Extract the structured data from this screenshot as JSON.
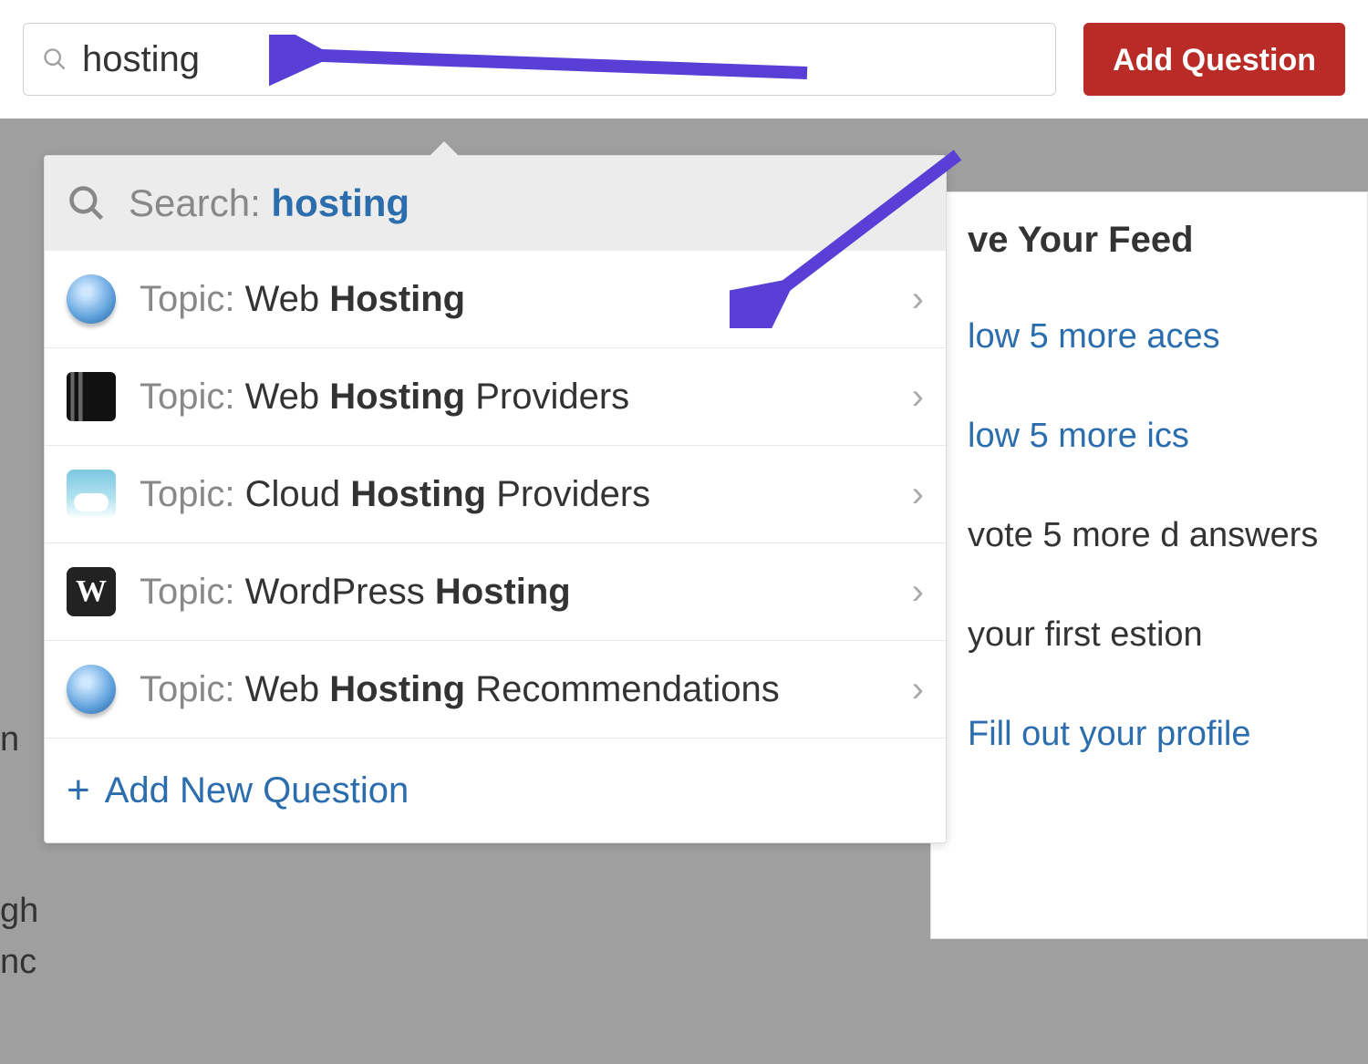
{
  "search": {
    "value": "hosting",
    "placeholder": ""
  },
  "add_question_button": "Add Question",
  "dropdown": {
    "search_label": "Search: ",
    "search_term": "hosting",
    "items": [
      {
        "prefix": "Topic: ",
        "pre": "Web ",
        "bold": "Hosting",
        "post": "",
        "icon": "globe"
      },
      {
        "prefix": "Topic: ",
        "pre": "Web ",
        "bold": "Hosting",
        "post": " Providers",
        "icon": "servers"
      },
      {
        "prefix": "Topic: ",
        "pre": "Cloud ",
        "bold": "Hosting",
        "post": " Providers",
        "icon": "cloud"
      },
      {
        "prefix": "Topic: ",
        "pre": "WordPress ",
        "bold": "Hosting",
        "post": "",
        "icon": "wp"
      },
      {
        "prefix": "Topic: ",
        "pre": "Web ",
        "bold": "Hosting",
        "post": " Recommendations",
        "icon": "globe"
      }
    ],
    "add_new": "Add New Question"
  },
  "feed": {
    "title": "ve Your Feed",
    "items": [
      "low 5 more aces",
      "low 5 more ics",
      "vote 5 more d answers",
      "your first estion",
      "Fill out your profile"
    ]
  },
  "cutoff": {
    "l1": "n",
    "l2": "gh",
    "l3": "nc"
  }
}
